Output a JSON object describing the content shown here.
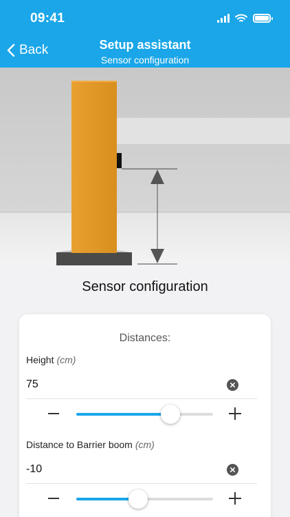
{
  "status_bar": {
    "time": "09:41"
  },
  "nav": {
    "back_label": "Back",
    "title": "Setup assistant",
    "subtitle": "Sensor configuration"
  },
  "page": {
    "heading": "Sensor configuration"
  },
  "distances": {
    "title": "Distances:",
    "fields": [
      {
        "label": "Height",
        "unit": "(cm)",
        "value": "75",
        "slider_fraction": 0.69
      },
      {
        "label": "Distance to Barrier boom",
        "unit": "(cm)",
        "value": "-10",
        "slider_fraction": 0.45
      }
    ]
  },
  "colors": {
    "header": "#1aa6e8",
    "accent": "#1aa6e8",
    "bollard": "#e29a2a"
  },
  "icons": [
    "back-chevron-icon",
    "signal-icon",
    "wifi-icon",
    "battery-icon",
    "clear-icon",
    "minus-icon",
    "plus-icon",
    "dimension-arrow-icon"
  ]
}
